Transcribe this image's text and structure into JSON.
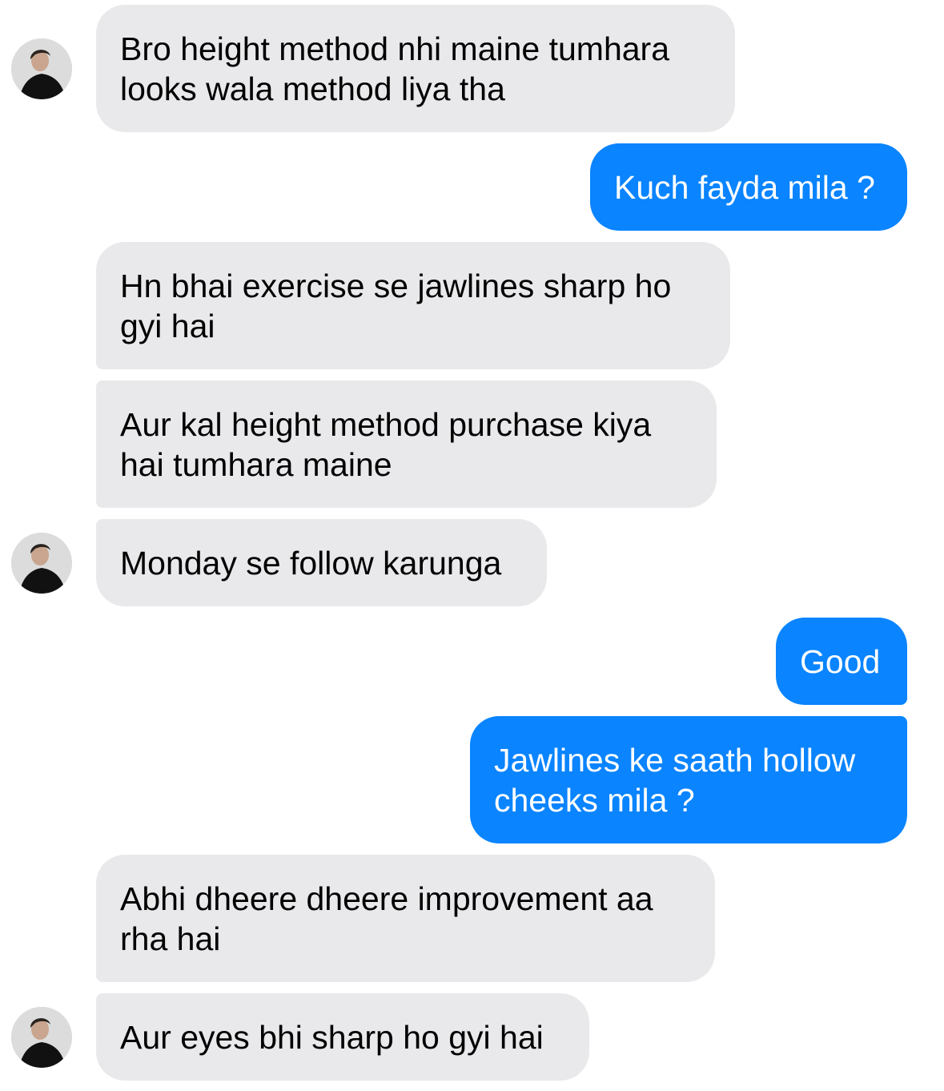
{
  "theme": {
    "incoming_bubble": "#e9e9eb",
    "outgoing_bubble": "#0a84ff",
    "incoming_text": "#000000",
    "outgoing_text": "#ffffff"
  },
  "contact": {
    "avatar_icon": "contact-avatar-icon"
  },
  "messages": [
    {
      "direction": "incoming",
      "text": "Bro height method nhi maine tumhara\nlooks wala method liya tha"
    },
    {
      "direction": "outgoing",
      "text": "Kuch fayda mila ?"
    },
    {
      "direction": "incoming",
      "text": "Hn bhai exercise se jawlines sharp ho\ngyi hai"
    },
    {
      "direction": "incoming",
      "text": "Aur kal height method purchase kiya\nhai tumhara maine"
    },
    {
      "direction": "incoming",
      "text": "Monday se follow karunga"
    },
    {
      "direction": "outgoing",
      "text": "Good"
    },
    {
      "direction": "outgoing",
      "text": "Jawlines ke saath hollow\ncheeks mila ?"
    },
    {
      "direction": "incoming",
      "text": "Abhi dheere dheere improvement aa\nrha hai"
    },
    {
      "direction": "incoming",
      "text": "Aur eyes bhi sharp ho gyi hai"
    }
  ]
}
